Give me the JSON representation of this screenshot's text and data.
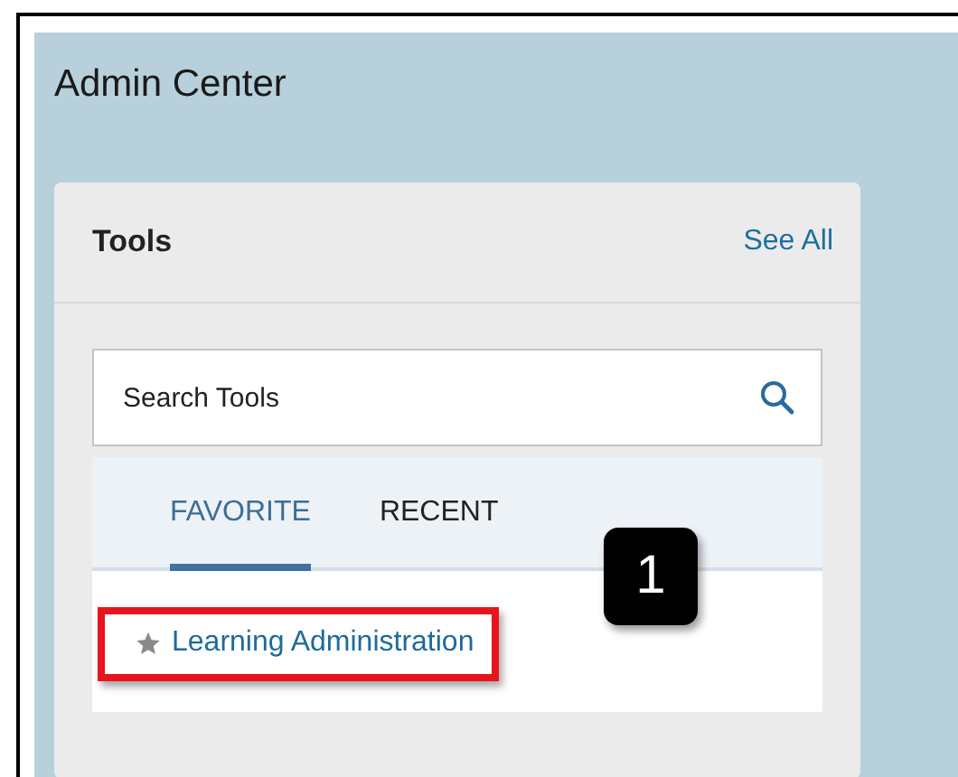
{
  "page_title": "Admin Center",
  "tools_card": {
    "title": "Tools",
    "see_all": "See All",
    "search": {
      "placeholder": "Search Tools"
    },
    "tabs": [
      {
        "label": "FAVORITE",
        "selected": true
      },
      {
        "label": "RECENT",
        "selected": false
      }
    ],
    "items": [
      {
        "label": "Learning Administration",
        "favorite": true,
        "highlighted": true
      }
    ]
  },
  "callout": {
    "number": "1"
  }
}
